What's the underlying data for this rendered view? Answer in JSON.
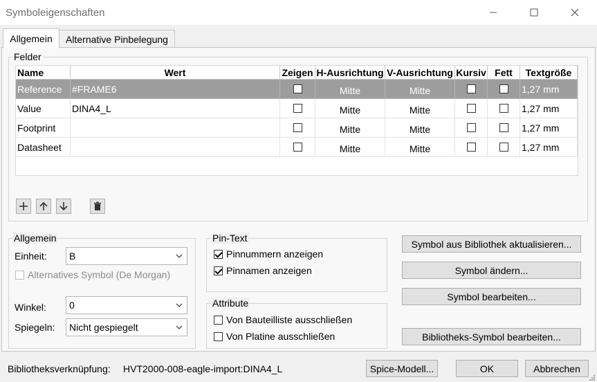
{
  "window": {
    "title": "Symboleigenschaften"
  },
  "tabs": [
    {
      "label": "Allgemein",
      "active": true
    },
    {
      "label": "Alternative Pinbelegung",
      "active": false
    }
  ],
  "fields": {
    "group_label": "Felder",
    "columns": [
      "Name",
      "Wert",
      "Zeigen",
      "H-Ausrichtung",
      "V-Ausrichtung",
      "Kursiv",
      "Fett",
      "Textgröße"
    ],
    "rows": [
      {
        "name": "Reference",
        "value": "#FRAME6",
        "show": false,
        "h_align": "Mitte",
        "v_align": "Mitte",
        "italic": false,
        "bold": false,
        "text_size": "1,27 mm",
        "selected": true
      },
      {
        "name": "Value",
        "value": "DINA4_L",
        "show": false,
        "h_align": "Mitte",
        "v_align": "Mitte",
        "italic": false,
        "bold": false,
        "text_size": "1,27 mm",
        "selected": false
      },
      {
        "name": "Footprint",
        "value": "",
        "show": false,
        "h_align": "Mitte",
        "v_align": "Mitte",
        "italic": false,
        "bold": false,
        "text_size": "1,27 mm",
        "selected": false
      },
      {
        "name": "Datasheet",
        "value": "",
        "show": false,
        "h_align": "Mitte",
        "v_align": "Mitte",
        "italic": false,
        "bold": false,
        "text_size": "1,27 mm",
        "selected": false
      }
    ],
    "toolbar": [
      "plus-icon",
      "arrow-up-icon",
      "arrow-down-icon",
      "trash-icon"
    ]
  },
  "general": {
    "group_label": "Allgemein",
    "unit_label": "Einheit:",
    "unit_value": "B",
    "alt_symbol_label": "Alternatives Symbol (De Morgan)",
    "alt_symbol_checked": false,
    "angle_label": "Winkel:",
    "angle_value": "0",
    "mirror_label": "Spiegeln:",
    "mirror_value": "Nicht gespiegelt"
  },
  "pin_text": {
    "group_label": "Pin-Text",
    "show_numbers_label": "Pinnummern anzeigen",
    "show_numbers_checked": true,
    "show_names_label": "Pinnamen anzeigen",
    "show_names_checked": true
  },
  "attributes": {
    "group_label": "Attribute",
    "exclude_bom_label": "Von Bauteilliste ausschließen",
    "exclude_bom_checked": false,
    "exclude_board_label": "Von Platine ausschließen",
    "exclude_board_checked": false
  },
  "actions": {
    "update_from_library": "Symbol aus Bibliothek aktualisieren...",
    "change_symbol": "Symbol ändern...",
    "edit_symbol": "Symbol bearbeiten...",
    "edit_library_symbol": "Bibliotheks-Symbol bearbeiten..."
  },
  "footer": {
    "library_link_label": "Bibliotheksverknüpfung:",
    "library_link_value": "HVT2000-008-eagle-import:DINA4_L",
    "spice_button": "Spice-Modell...",
    "ok_button": "OK",
    "cancel_button": "Abbrechen"
  },
  "colors": {
    "selected_row": "#9d9d9d",
    "window_bg": "#f0f0f0",
    "button_bg": "#e1e1e1"
  }
}
